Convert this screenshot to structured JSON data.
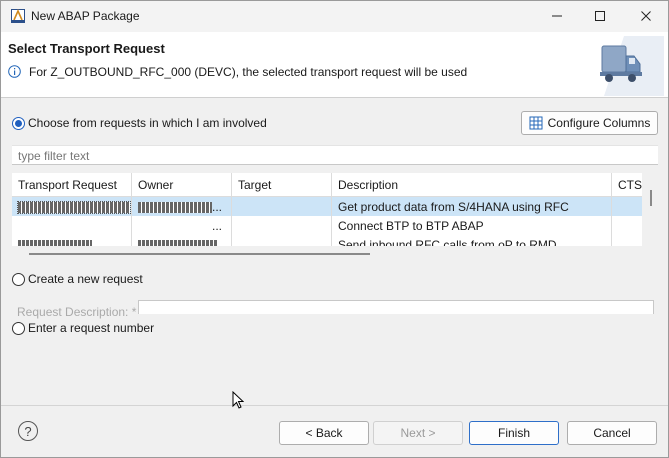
{
  "window": {
    "title": "New ABAP Package"
  },
  "banner": {
    "title": "Select Transport Request",
    "message": "For Z_OUTBOUND_RFC_000 (DEVC), the selected transport request will be used",
    "icon": "info-icon",
    "illustration": "truck-icon"
  },
  "options": {
    "involved_label": "Choose from requests in which I am involved",
    "involved_selected": true,
    "create_label": "Create a new request",
    "enter_label": "Enter a request number"
  },
  "configure_columns_label": "Configure Columns",
  "filter": {
    "placeholder": "type filter text"
  },
  "table": {
    "columns": [
      "Transport Request",
      "Owner",
      "Target",
      "Description",
      "CTS"
    ],
    "rows": [
      {
        "request": "",
        "owner": "...",
        "target": "",
        "description": "Get product data from S/4HANA using RFC",
        "cts": "",
        "selected": true
      },
      {
        "request": "",
        "owner": "...",
        "target": "",
        "description": "Connect BTP to BTP ABAP",
        "cts": "",
        "selected": false
      },
      {
        "request": "",
        "owner": "",
        "target": "",
        "description": "Send inbound RFC calls from oP to RMD",
        "cts": "",
        "selected": false
      }
    ]
  },
  "request_description_label": "Request Description: *",
  "buttons": {
    "back": "< Back",
    "next": "Next >",
    "finish": "Finish",
    "cancel": "Cancel",
    "help": "?"
  },
  "colors": {
    "selection": "#cce4f7",
    "accent": "#1f5fbf"
  }
}
